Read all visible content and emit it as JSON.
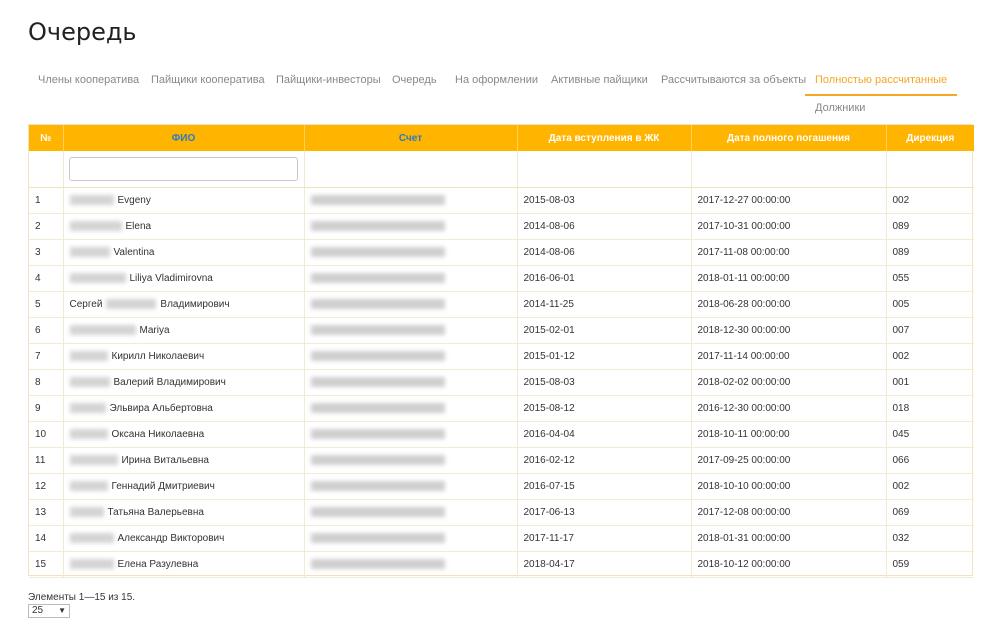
{
  "page": {
    "title": "Очередь"
  },
  "tabs": [
    {
      "label": "Члены кооператива"
    },
    {
      "label": "Пайщики кооператива"
    },
    {
      "label": "Пайщики-инвесторы"
    },
    {
      "label": "Очередь"
    },
    {
      "label": "На оформлении"
    },
    {
      "label": "Активные пайщики"
    },
    {
      "label": "Рассчитываются за объекты"
    },
    {
      "label": "Полностью рассчитанные"
    },
    {
      "label": "Должники"
    }
  ],
  "active_tab": "Полностью рассчитанные",
  "table": {
    "columns": [
      "№",
      "ФИО",
      "Счет",
      "Дата вступления в ЖК",
      "Дата полного погашения",
      "Дирекция"
    ],
    "rows": [
      {
        "num": "1",
        "name": "Evgeny",
        "joined": "2015-08-03",
        "paid": "2017-12-27 00:00:00",
        "dir": "002"
      },
      {
        "num": "2",
        "name": "Elena",
        "joined": "2014-08-06",
        "paid": "2017-10-31 00:00:00",
        "dir": "089"
      },
      {
        "num": "3",
        "name": "Valentina",
        "joined": "2014-08-06",
        "paid": "2017-11-08 00:00:00",
        "dir": "089"
      },
      {
        "num": "4",
        "name": "Liliya Vladimirovna",
        "joined": "2016-06-01",
        "paid": "2018-01-11 00:00:00",
        "dir": "055"
      },
      {
        "num": "5",
        "first": "Сергей",
        "name": "Владимирович",
        "joined": "2014-11-25",
        "paid": "2018-06-28 00:00:00",
        "dir": "005"
      },
      {
        "num": "6",
        "name": "Mariya",
        "joined": "2015-02-01",
        "paid": "2018-12-30 00:00:00",
        "dir": "007"
      },
      {
        "num": "7",
        "name": "Кирилл Николаевич",
        "joined": "2015-01-12",
        "paid": "2017-11-14 00:00:00",
        "dir": "002"
      },
      {
        "num": "8",
        "name": "Валерий Владимирович",
        "joined": "2015-08-03",
        "paid": "2018-02-02 00:00:00",
        "dir": "001"
      },
      {
        "num": "9",
        "name": "Эльвира Альбертовна",
        "joined": "2015-08-12",
        "paid": "2016-12-30 00:00:00",
        "dir": "018"
      },
      {
        "num": "10",
        "name": "Оксана Николаевна",
        "joined": "2016-04-04",
        "paid": "2018-10-11 00:00:00",
        "dir": "045"
      },
      {
        "num": "11",
        "name": "Ирина Витальевна",
        "joined": "2016-02-12",
        "paid": "2017-09-25 00:00:00",
        "dir": "066"
      },
      {
        "num": "12",
        "name": "Геннадий Дмитриевич",
        "joined": "2016-07-15",
        "paid": "2018-10-10 00:00:00",
        "dir": "002"
      },
      {
        "num": "13",
        "name": "Татьяна Валерьевна",
        "joined": "2017-06-13",
        "paid": "2017-12-08 00:00:00",
        "dir": "069"
      },
      {
        "num": "14",
        "name": "Александр Викторович",
        "joined": "2017-11-17",
        "paid": "2018-01-31 00:00:00",
        "dir": "032"
      },
      {
        "num": "15",
        "name": "Елена Разулевна",
        "joined": "2018-04-17",
        "paid": "2018-10-12 00:00:00",
        "dir": "059"
      }
    ]
  },
  "footer": {
    "summary": "Элементы 1—15 из 15.",
    "page_size": "25"
  },
  "colors": {
    "accent": "#ffb400",
    "active_tab": "#f5a623",
    "sort_link": "#2a7ac7"
  }
}
